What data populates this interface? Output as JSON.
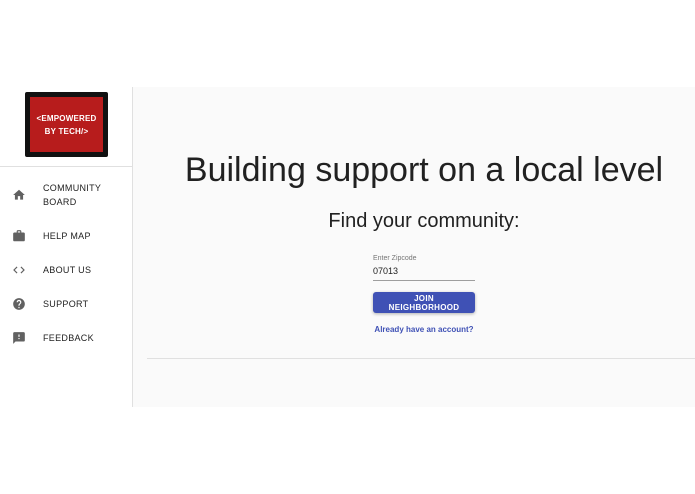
{
  "logo": {
    "line1": "<EMPOWERED",
    "line2": "BY TECH/>"
  },
  "sidebar": {
    "items": [
      {
        "icon": "home-icon",
        "line1": "COMMUNITY",
        "line2": "BOARD"
      },
      {
        "icon": "briefcase-icon",
        "label": "HELP MAP"
      },
      {
        "icon": "code-icon",
        "label": "ABOUT US"
      },
      {
        "icon": "help-icon",
        "label": "SUPPORT"
      },
      {
        "icon": "feedback-icon",
        "label": "FEEDBACK"
      }
    ]
  },
  "main": {
    "headline": "Building support on a local level",
    "subhead": "Find your community:",
    "zipcode": {
      "label": "Enter Zipcode",
      "value": "07013"
    },
    "join_label": "JOIN NEIGHBORHOOD",
    "account_link": "Already have an account?"
  },
  "colors": {
    "primary": "#3f51b5",
    "logo_red": "#b71c1c",
    "logo_frame": "#111111",
    "main_bg": "#fafafa"
  }
}
